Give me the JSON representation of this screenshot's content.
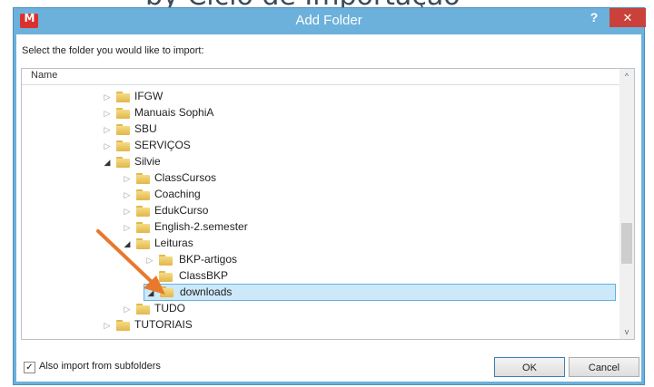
{
  "top_fragment": "by Ciclo de Importação",
  "window": {
    "title": "Add Folder",
    "app_icon_glyph": "M",
    "help_glyph": "?",
    "close_glyph": "✕"
  },
  "prompt": "Select the folder you would like to import:",
  "tree": {
    "column_header": "Name",
    "rows": [
      {
        "label": "IFGW",
        "expander": "▷"
      },
      {
        "label": "Manuais SophiA",
        "expander": "▷"
      },
      {
        "label": "SBU",
        "expander": "▷"
      },
      {
        "label": "SERVIÇOS",
        "expander": "▷"
      },
      {
        "label": "Silvie",
        "expander": "◢"
      },
      {
        "label": "ClassCursos",
        "expander": "▷"
      },
      {
        "label": "Coaching",
        "expander": "▷"
      },
      {
        "label": "EdukCurso",
        "expander": "▷"
      },
      {
        "label": "English-2.semester",
        "expander": "▷"
      },
      {
        "label": "Leituras",
        "expander": "◢"
      },
      {
        "label": "BKP-artigos",
        "expander": "▷"
      },
      {
        "label": "ClassBKP",
        "expander": ""
      },
      {
        "label": "downloads",
        "expander": "◢",
        "selected": true
      },
      {
        "label": "TUDO",
        "expander": "▷"
      },
      {
        "label": "TUTORIAIS",
        "expander": "▷"
      }
    ],
    "scroll_up_glyph": "^",
    "scroll_down_glyph": "v"
  },
  "options": {
    "import_subfolders_label": "Also import from subfolders",
    "import_subfolders_checked": true,
    "check_glyph": "✓"
  },
  "buttons": {
    "ok": "OK",
    "cancel": "Cancel"
  },
  "colors": {
    "titlebar": "#6cb1dc",
    "close": "#c9413a",
    "selection": "#cde8f8",
    "arrow": "#e8782e"
  }
}
